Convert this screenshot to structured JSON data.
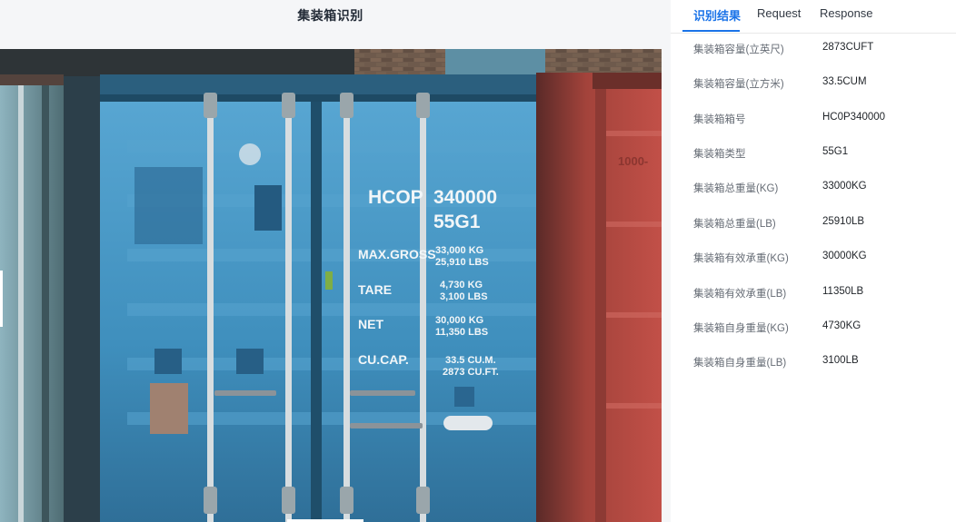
{
  "page": {
    "title": "集装箱识别"
  },
  "image": {
    "container_id": "HCOP",
    "container_no": "340000",
    "type_code": "55G1",
    "specs": [
      {
        "label": "MAX.GROSS",
        "v1": "33,000 KG",
        "v2": "25,910 LBS"
      },
      {
        "label": "TARE",
        "v1": "4,730 KG",
        "v2": "3,100 LBS"
      },
      {
        "label": "NET",
        "v1": "30,000 KG",
        "v2": "11,350 LBS"
      },
      {
        "label": "CU.CAP.",
        "v1": "33.5 CU.M.",
        "v2": "2873 CU.FT."
      }
    ],
    "side_text": "1000-",
    "colors": {
      "container_blue": "#4a9bc8",
      "red_container": "#b94a42",
      "wall": "#6b5a4e"
    }
  },
  "tabs": [
    "识别结果",
    "Request",
    "Response"
  ],
  "active_tab": "识别结果",
  "results": [
    {
      "key": "集装箱容量(立英尺)",
      "value": "2873CUFT"
    },
    {
      "key": "集装箱容量(立方米)",
      "value": "33.5CUM"
    },
    {
      "key": "集装箱箱号",
      "value": "HC0P340000"
    },
    {
      "key": "集装箱类型",
      "value": "55G1"
    },
    {
      "key": "集装箱总重量(KG)",
      "value": "33000KG"
    },
    {
      "key": "集装箱总重量(LB)",
      "value": "25910LB"
    },
    {
      "key": "集装箱有效承重(KG)",
      "value": "30000KG"
    },
    {
      "key": "集装箱有效承重(LB)",
      "value": "11350LB"
    },
    {
      "key": "集装箱自身重量(KG)",
      "value": "4730KG"
    },
    {
      "key": "集装箱自身重量(LB)",
      "value": "3100LB"
    }
  ],
  "accent_color": "#1a73e8"
}
